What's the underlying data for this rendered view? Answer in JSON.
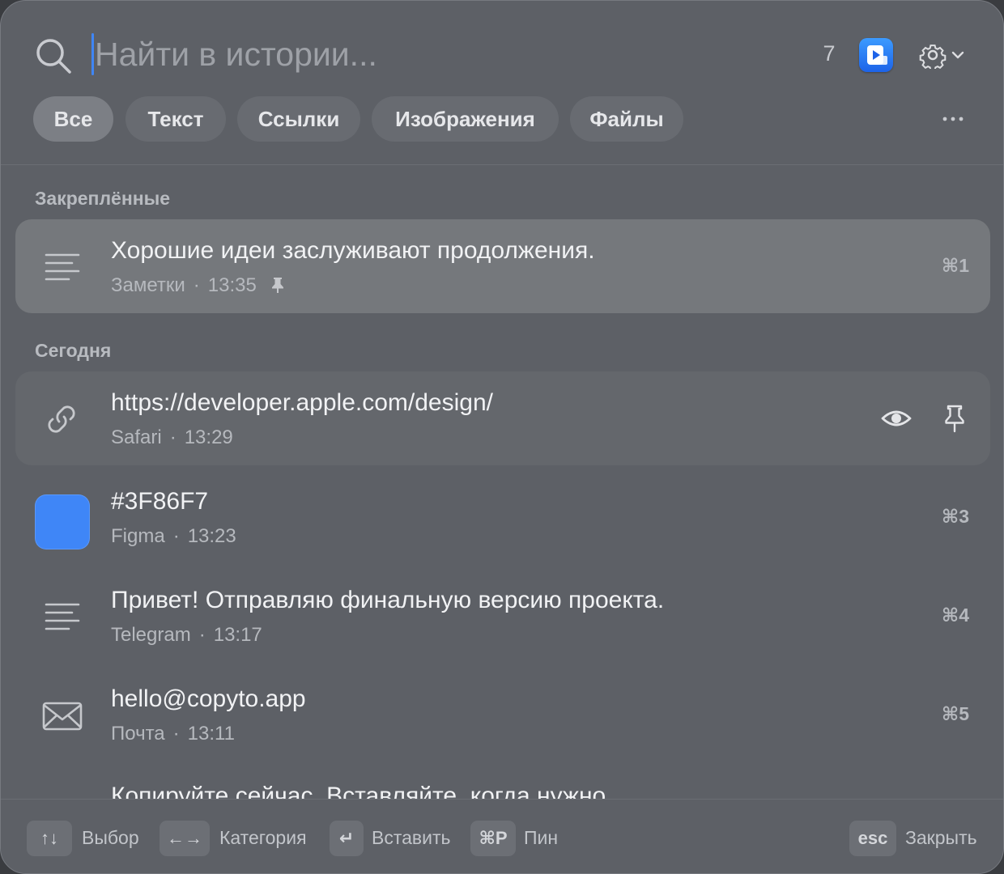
{
  "search": {
    "placeholder": "Найти в истории...",
    "count": "7"
  },
  "filters": [
    "Все",
    "Текст",
    "Ссылки",
    "Изображения",
    "Файлы"
  ],
  "active_filter": "Все",
  "sections": {
    "pinned": "Закреплённые",
    "today": "Сегодня"
  },
  "items": [
    {
      "title": "Хорошие идеи заслуживают продолжения.",
      "source": "Заметки",
      "time": "13:35",
      "shortcut": "⌘1",
      "icon": "text-lines-icon",
      "pinned": true
    },
    {
      "title": "https://developer.apple.com/design/",
      "source": "Safari",
      "time": "13:29",
      "icon": "link-icon"
    },
    {
      "title": "#3F86F7",
      "source": "Figma",
      "time": "13:23",
      "shortcut": "⌘3",
      "icon": "color-swatch"
    },
    {
      "title": "Привет! Отправляю финальную версию проекта.",
      "source": "Telegram",
      "time": "13:17",
      "shortcut": "⌘4",
      "icon": "text-lines-icon"
    },
    {
      "title": "hello@copyto.app",
      "source": "Почта",
      "time": "13:11",
      "shortcut": "⌘5",
      "icon": "mail-icon"
    },
    {
      "title": "Копируйте сейчас. Вставляйте, когда нужно."
    }
  ],
  "footer": [
    {
      "key": "↑↓",
      "label": "Выбор"
    },
    {
      "key": "←→",
      "label": "Категория"
    },
    {
      "key": "↵",
      "label": "Вставить"
    },
    {
      "key": "⌘P",
      "label": "Пин"
    },
    {
      "key": "esc",
      "label": "Закрыть"
    }
  ],
  "colors": {
    "accent": "#3f86f7",
    "swatch": "#3F86F7",
    "background": "#5d6066"
  }
}
